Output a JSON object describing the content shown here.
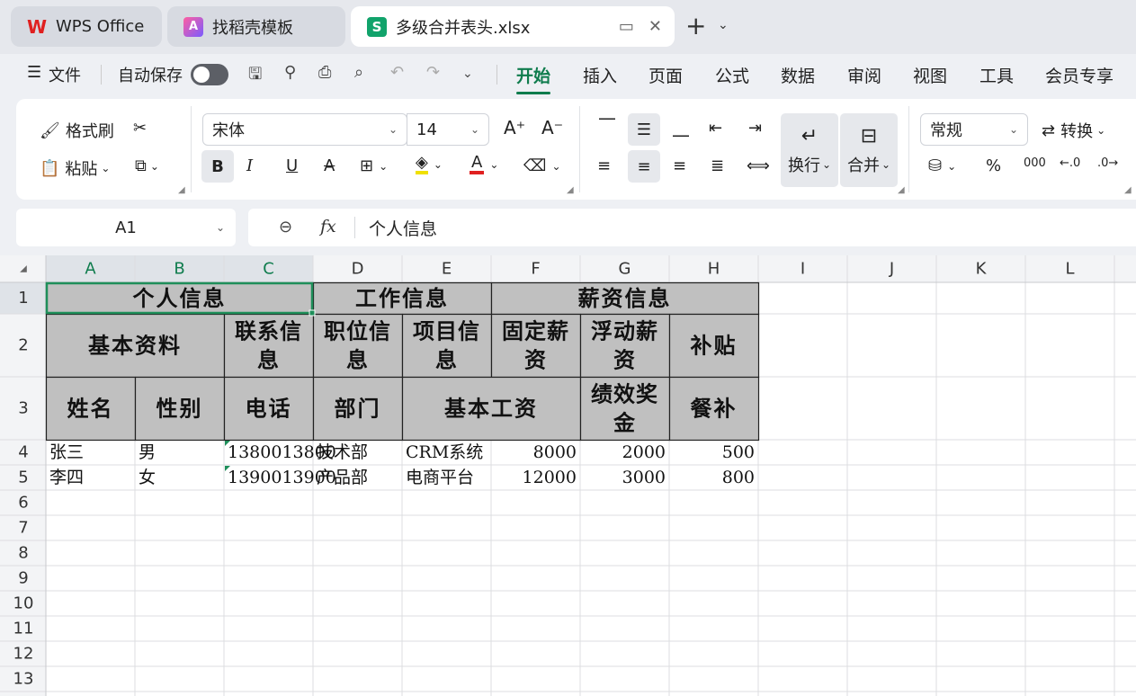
{
  "tabs": [
    {
      "label": "WPS Office",
      "icon": "wps-logo-icon"
    },
    {
      "label": "找稻壳模板",
      "icon": "template-icon"
    },
    {
      "label": "多级合并表头.xlsx",
      "icon": "spreadsheet-icon"
    }
  ],
  "menu": {
    "file_label": "文件",
    "autosave_label": "自动保存",
    "tabs": [
      "开始",
      "插入",
      "页面",
      "公式",
      "数据",
      "审阅",
      "视图",
      "工具",
      "会员专享"
    ],
    "active_tab": "开始"
  },
  "ribbon": {
    "format_painter": "格式刷",
    "paste": "粘贴",
    "font_name": "宋体",
    "font_size": "14",
    "wrap_text": "换行",
    "merge": "合并",
    "number_format": "常规",
    "convert": "转换",
    "percent": "%",
    "thousands": "000"
  },
  "formula_bar": {
    "cell_ref": "A1",
    "fx": "fx",
    "value": "个人信息"
  },
  "grid": {
    "columns": [
      "A",
      "B",
      "C",
      "D",
      "E",
      "F",
      "G",
      "H",
      "I",
      "J",
      "K",
      "L"
    ],
    "rows": [
      "1",
      "2",
      "3",
      "4",
      "5",
      "6",
      "7",
      "8",
      "9",
      "10",
      "11",
      "12",
      "13"
    ],
    "header_cells": {
      "r1_personal": "个人信息",
      "r1_work": "工作信息",
      "r1_salary": "薪资信息",
      "r2_basic": "基本资料",
      "r2_contact": [
        "联系信",
        "息"
      ],
      "r2_position": [
        "职位信",
        "息"
      ],
      "r2_project": [
        "项目信",
        "息"
      ],
      "r2_fixed": [
        "固定薪",
        "资"
      ],
      "r2_float": [
        "浮动薪",
        "资"
      ],
      "r2_subsidy": "补贴",
      "r3_name": "姓名",
      "r3_gender": "性别",
      "r3_phone": "电话",
      "r3_dept": "部门",
      "r3_basesalary": "基本工资",
      "r3_bonus": [
        "绩效奖",
        "金"
      ],
      "r3_meal": "餐补"
    },
    "data_rows": [
      [
        "张三",
        "男",
        "13800138000",
        "技术部",
        "CRM系统",
        "8000",
        "2000",
        "500"
      ],
      [
        "李四",
        "女",
        "13900139000",
        "产品部",
        "电商平台",
        "12000",
        "3000",
        "800"
      ]
    ]
  },
  "colors": {
    "accent": "#0f7c4d",
    "header_fill": "#c0c0c0",
    "selection": "#1e8f5a"
  }
}
